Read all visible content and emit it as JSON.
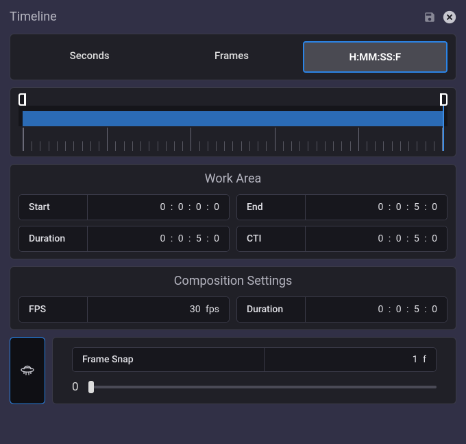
{
  "header": {
    "title": "Timeline"
  },
  "tabs": {
    "items": [
      {
        "label": "Seconds"
      },
      {
        "label": "Frames"
      },
      {
        "label": "H:MM:SS:F"
      }
    ],
    "active_index": 2
  },
  "work_area": {
    "title": "Work Area",
    "start_label": "Start",
    "start_value": "0 : 0 : 0 : 0",
    "end_label": "End",
    "end_value": "0 : 0 : 5 : 0",
    "duration_label": "Duration",
    "duration_value": "0 : 0 : 5 : 0",
    "cti_label": "CTI",
    "cti_value": "0 : 0 : 5 : 0"
  },
  "composition": {
    "title": "Composition Settings",
    "fps_label": "FPS",
    "fps_value": "30 fps",
    "duration_label": "Duration",
    "duration_value": "0 : 0 : 5 : 0"
  },
  "frame_snap": {
    "label": "Frame Snap",
    "value": "1 f",
    "slider_display": "0"
  }
}
